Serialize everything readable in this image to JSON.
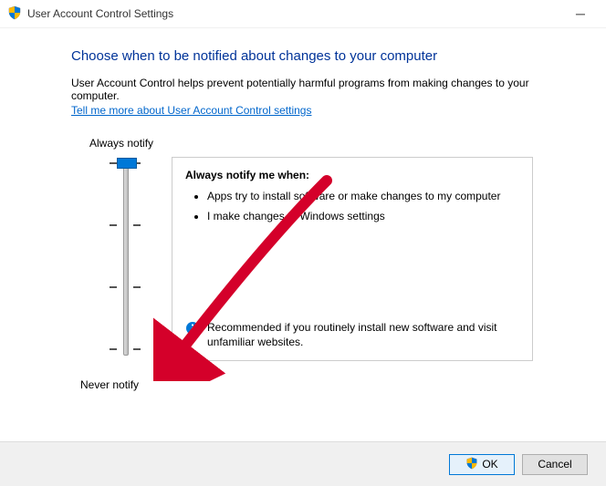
{
  "titlebar": {
    "title": "User Account Control Settings"
  },
  "heading": "Choose when to be notified about changes to your computer",
  "description": "User Account Control helps prevent potentially harmful programs from making changes to your computer.",
  "link_text": "Tell me more about User Account Control settings",
  "slider": {
    "top_label": "Always notify",
    "bottom_label": "Never notify",
    "num_positions": 4,
    "position_index": 0
  },
  "panel": {
    "title": "Always notify me when:",
    "bullets": [
      "Apps try to install software or make changes to my computer",
      "I make changes to Windows settings"
    ],
    "recommendation": "Recommended if you routinely install new software and visit unfamiliar websites."
  },
  "buttons": {
    "ok": "OK",
    "cancel": "Cancel"
  },
  "icons": {
    "shield": "shield-icon",
    "info": "info-icon"
  }
}
